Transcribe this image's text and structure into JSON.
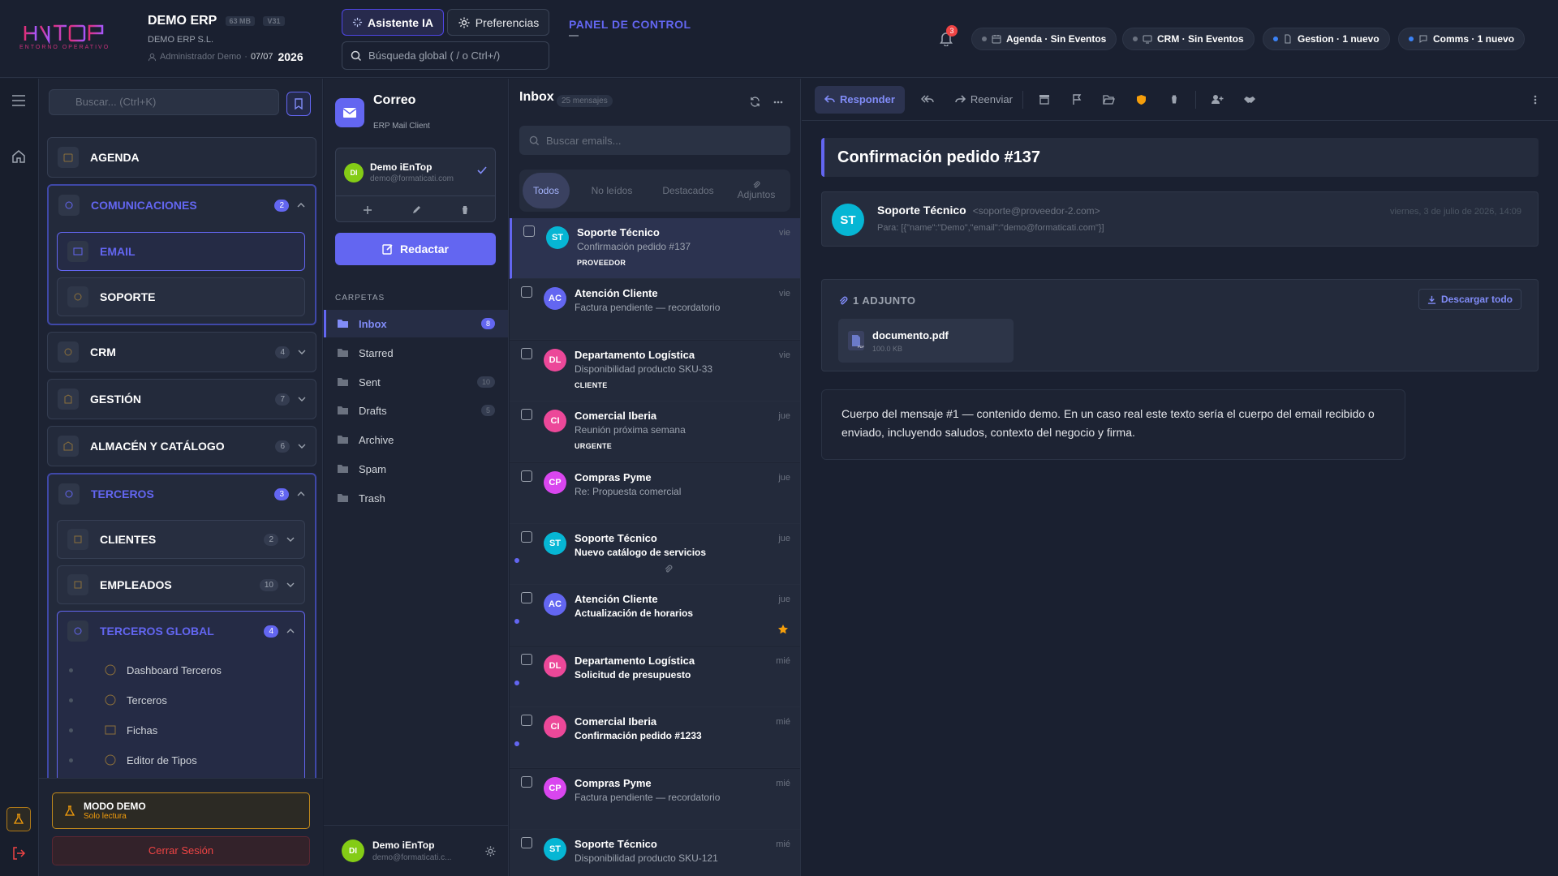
{
  "app": {
    "logo_text": "iEnTop",
    "logo_sub": "ENTORNO OPERATIVO",
    "title": "DEMO ERP",
    "mem_badge": "63 MB",
    "version_badge": "V31",
    "company": "DEMO ERP S.L.",
    "user": "Administrador Demo",
    "date_short": "07/07",
    "year": "2026"
  },
  "topbar": {
    "ai_button": "Asistente IA",
    "prefs_button": "Preferencias",
    "search_placeholder": "Búsqueda global ( / o Ctrl+/)",
    "panel_title": "PANEL DE CONTROL",
    "notif_count": "3",
    "status": [
      {
        "label": "Agenda · Sin Eventos",
        "dot": "gray"
      },
      {
        "label": "CRM · Sin Eventos",
        "dot": "gray"
      },
      {
        "label": "Gestion · 1 nuevo",
        "dot": "blue"
      },
      {
        "label": "Comms · 1 nuevo",
        "dot": "blue"
      }
    ]
  },
  "sidebar": {
    "search_placeholder": "Buscar... (Ctrl+K)",
    "agenda": "AGENDA",
    "comunicaciones": {
      "label": "COMUNICACIONES",
      "badge": "2"
    },
    "email": "EMAIL",
    "soporte": "SOPORTE",
    "crm": {
      "label": "CRM",
      "badge": "4"
    },
    "gestion": {
      "label": "GESTIÓN",
      "badge": "7"
    },
    "almacen": {
      "label": "ALMACÉN Y CATÁLOGO",
      "badge": "6"
    },
    "terceros": {
      "label": "TERCEROS",
      "badge": "3"
    },
    "clientes": {
      "label": "CLIENTES",
      "badge": "2"
    },
    "empleados": {
      "label": "EMPLEADOS",
      "badge": "10"
    },
    "terceros_global": {
      "label": "TERCEROS GLOBAL",
      "badge": "4"
    },
    "leaves": [
      "Dashboard Terceros",
      "Terceros",
      "Fichas",
      "Editor de Tipos"
    ],
    "demo_title": "MODO DEMO",
    "demo_sub": "Solo lectura",
    "logout": "Cerrar Sesión"
  },
  "mail": {
    "title": "Correo",
    "subtitle": "ERP Mail Client",
    "account_name": "Demo iEnTop",
    "account_email": "demo@formaticati.com",
    "account_initials": "DI",
    "compose": "Redactar",
    "folders_heading": "CARPETAS",
    "folders": [
      {
        "name": "Inbox",
        "count": "8"
      },
      {
        "name": "Starred",
        "count": ""
      },
      {
        "name": "Sent",
        "count": "10"
      },
      {
        "name": "Drafts",
        "count": "5"
      },
      {
        "name": "Archive",
        "count": ""
      },
      {
        "name": "Spam",
        "count": ""
      },
      {
        "name": "Trash",
        "count": ""
      }
    ],
    "footer_name": "Demo iEnTop",
    "footer_email": "demo@formaticati.c..."
  },
  "inbox": {
    "title": "Inbox",
    "count": "25 mensajes",
    "search_placeholder": "Buscar emails...",
    "tabs": [
      "Todos",
      "No leídos",
      "Destacados",
      "Adjuntos"
    ],
    "messages": [
      {
        "initials": "ST",
        "color": "#06b6d4",
        "from": "Soporte Técnico",
        "subject": "Confirmación pedido #137",
        "when": "vie",
        "tag": "PROVEEDOR",
        "unread": false
      },
      {
        "initials": "AC",
        "color": "#6366f1",
        "from": "Atención Cliente",
        "subject": "Factura pendiente — recordatorio",
        "when": "vie",
        "tag": "",
        "unread": false
      },
      {
        "initials": "DL",
        "color": "#ec4899",
        "from": "Departamento Logística",
        "subject": "Disponibilidad producto SKU-33",
        "when": "vie",
        "tag": "CLIENTE",
        "unread": false
      },
      {
        "initials": "CI",
        "color": "#ec4899",
        "from": "Comercial Iberia",
        "subject": "Reunión próxima semana",
        "when": "jue",
        "tag": "URGENTE",
        "unread": false
      },
      {
        "initials": "CP",
        "color": "#d946ef",
        "from": "Compras Pyme",
        "subject": "Re: Propuesta comercial",
        "when": "jue",
        "tag": "",
        "unread": false
      },
      {
        "initials": "ST",
        "color": "#06b6d4",
        "from": "Soporte Técnico",
        "subject": "Nuevo catálogo de servicios",
        "when": "jue",
        "tag": "",
        "unread": true
      },
      {
        "initials": "AC",
        "color": "#6366f1",
        "from": "Atención Cliente",
        "subject": "Actualización de horarios",
        "when": "jue",
        "tag": "",
        "unread": true
      },
      {
        "initials": "DL",
        "color": "#ec4899",
        "from": "Departamento Logística",
        "subject": "Solicitud de presupuesto",
        "when": "mié",
        "tag": "",
        "unread": true
      },
      {
        "initials": "CI",
        "color": "#ec4899",
        "from": "Comercial Iberia",
        "subject": "Confirmación pedido #1233",
        "when": "mié",
        "tag": "",
        "unread": true
      },
      {
        "initials": "CP",
        "color": "#d946ef",
        "from": "Compras Pyme",
        "subject": "Factura pendiente — recordatorio",
        "when": "mié",
        "tag": "",
        "unread": false
      },
      {
        "initials": "ST",
        "color": "#06b6d4",
        "from": "Soporte Técnico",
        "subject": "Disponibilidad producto SKU-121",
        "when": "mié",
        "tag": "",
        "unread": false
      }
    ]
  },
  "reader": {
    "reply": "Responder",
    "forward": "Reenviar",
    "subject": "Confirmación pedido #137",
    "sender_initials": "ST",
    "sender_name": "Soporte Técnico",
    "sender_email": "<soporte@proveedor-2.com>",
    "to_line": "Para: [{\"name\":\"Demo\",\"email\":\"demo@formaticati.com\"}]",
    "date": "viernes, 3 de julio de 2026, 14:09",
    "attach_heading": "1 ADJUNTO",
    "download_all": "Descargar todo",
    "attachment_name": "documento.pdf",
    "attachment_size": "100.0 KB",
    "body": "Cuerpo del mensaje #1 — contenido demo. En un caso real este texto sería el cuerpo del email recibido o enviado, incluyendo saludos, contexto del negocio y firma."
  },
  "colors": {
    "accent": "#6366f1",
    "warning": "#f59e0b",
    "danger": "#ef4444"
  }
}
